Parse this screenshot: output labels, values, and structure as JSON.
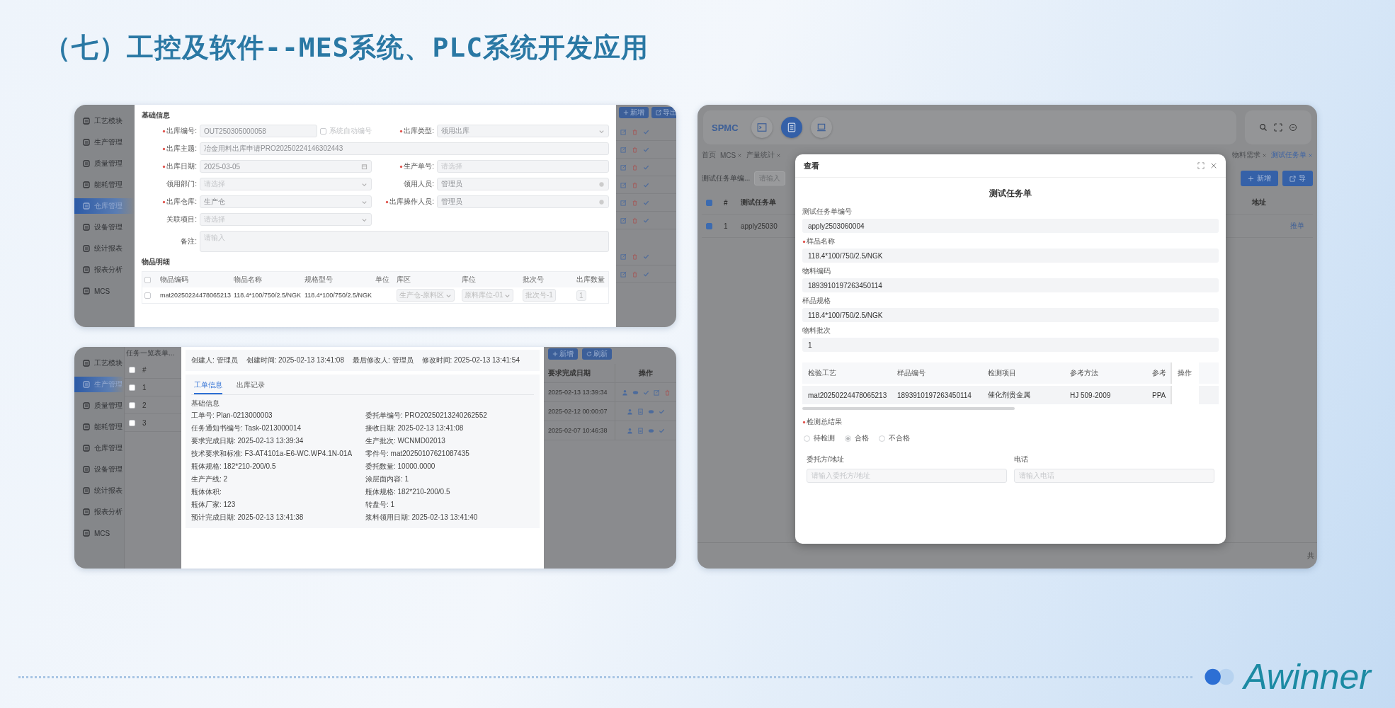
{
  "slide": {
    "title": "（七）工控及软件--MES系统、PLC系统开发应用",
    "logo": "Awinner"
  },
  "outbound_screen": {
    "sidebar": [
      {
        "label": "工艺模块",
        "selected": false
      },
      {
        "label": "生产管理",
        "selected": false
      },
      {
        "label": "质量管理",
        "selected": false
      },
      {
        "label": "能耗管理",
        "selected": false
      },
      {
        "label": "仓库管理",
        "selected": true
      },
      {
        "label": "设备管理",
        "selected": false
      },
      {
        "label": "统计报表",
        "selected": false
      },
      {
        "label": "报表分析",
        "selected": false
      },
      {
        "label": "MCS",
        "selected": false
      }
    ],
    "section_basic": "基础信息",
    "form_rows": [
      {
        "kind": "pair",
        "fields": [
          {
            "label": "出库编号:",
            "required": true,
            "kind": "text",
            "value": "OUT250305000058",
            "option": {
              "label": "系统自动编号",
              "checked": false
            }
          },
          {
            "label": "出库类型:",
            "required": true,
            "kind": "select",
            "value": "领用出库"
          }
        ]
      },
      {
        "kind": "wide",
        "fields": [
          {
            "label": "出库主题:",
            "required": true,
            "kind": "text",
            "value": "冶金用料出库申请PRO20250224146302443"
          }
        ]
      },
      {
        "kind": "pair",
        "fields": [
          {
            "label": "出库日期:",
            "required": true,
            "kind": "date",
            "value": "2025-03-05"
          },
          {
            "label": "生产单号:",
            "required": true,
            "kind": "text",
            "placeholder": "请选择"
          }
        ]
      },
      {
        "kind": "pair",
        "fields": [
          {
            "label": "领用部门:",
            "required": false,
            "kind": "select",
            "placeholder": "请选择"
          },
          {
            "label": "领用人员:",
            "required": false,
            "kind": "person",
            "value": "管理员"
          }
        ]
      },
      {
        "kind": "pair",
        "fields": [
          {
            "label": "出库仓库:",
            "required": true,
            "kind": "select",
            "value": "生产仓"
          },
          {
            "label": "出库操作人员:",
            "required": true,
            "kind": "person",
            "value": "管理员"
          }
        ]
      },
      {
        "kind": "pair",
        "fields": [
          {
            "label": "关联项目:",
            "required": false,
            "kind": "select",
            "placeholder": "请选择"
          }
        ]
      },
      {
        "kind": "wide",
        "fields": [
          {
            "label": "备注:",
            "required": false,
            "kind": "textarea",
            "placeholder": "请输入"
          }
        ]
      }
    ],
    "section_items": "物品明细",
    "items_table": {
      "header_checked": false,
      "columns": [
        "物品编码",
        "物品名称",
        "规格型号",
        "单位",
        "库区",
        "库位",
        "批次号",
        "出库数量"
      ],
      "rows": [
        {
          "checked": false,
          "code": "mat20250224478065213",
          "name": "118.4*100/750/2.5/NGK",
          "spec": "118.4*100/750/2.5/NGK",
          "zone": "生产仓-原料区",
          "location": "原料库位-01",
          "batch": "批次号-1",
          "quantity": "1"
        }
      ]
    },
    "toolbar_buttons": [
      {
        "label": "新增",
        "kind": "add"
      },
      {
        "label": "导出",
        "kind": "export"
      }
    ]
  },
  "work_order_screen": {
    "sidebar": [
      {
        "label": "工艺模块",
        "selected": false
      },
      {
        "label": "生产管理",
        "selected": true
      },
      {
        "label": "质量管理",
        "selected": false
      },
      {
        "label": "能耗管理",
        "selected": false
      },
      {
        "label": "仓库管理",
        "selected": false
      },
      {
        "label": "设备管理",
        "selected": false
      },
      {
        "label": "统计报表",
        "selected": false
      },
      {
        "label": "报表分析",
        "selected": false
      },
      {
        "label": "MCS",
        "selected": false
      }
    ],
    "list_title": "任务一览表单...",
    "list_header": "#",
    "list_header_checked": false,
    "list_rows": [
      {
        "index": "1",
        "checked": false
      },
      {
        "index": "2",
        "checked": false
      },
      {
        "index": "3",
        "checked": false
      }
    ],
    "meta": [
      "创建人: 管理员",
      "创建时间: 2025-02-13 13:41:08",
      "最后修改人: 管理员",
      "修改时间: 2025-02-13 13:41:54"
    ],
    "tabs": [
      {
        "label": "工单信息",
        "selected": true
      },
      {
        "label": "出库记录",
        "selected": false
      }
    ],
    "section": "基础信息",
    "details_left": [
      "工单号: Plan-0213000003",
      "任务通知书编号: Task-0213000014",
      "要求完成日期: 2025-02-13 13:39:34",
      "技术要求和标准: F3-AT4101a-E6-WC.WP4.1N-01A",
      "瓶体规格: 182*210-200/0.5",
      "生产产线: 2",
      "瓶体体积:",
      "瓶体厂家: 123",
      "预计完成日期: 2025-02-13 13:41:38"
    ],
    "details_right": [
      "委托单编号: PRO20250213240262552",
      "接收日期: 2025-02-13 13:41:08",
      "生产批次: WCNMD02013",
      "零件号: mat20250107621087435",
      "委托数量: 10000.0000",
      "涂层面内容: 1",
      "瓶体规格: 182*210-200/0.5",
      "转盘号: 1",
      "浆料领用日期: 2025-02-13 13:41:40"
    ],
    "toolbar_buttons": [
      {
        "label": "新增",
        "kind": "add"
      },
      {
        "label": "刷新",
        "kind": "refresh"
      }
    ],
    "table": {
      "columns": [
        "要求完成日期",
        "操作"
      ],
      "rows": [
        {
          "date": "2025-02-13 13:39:34",
          "actions": [
            {
              "kind": "assign"
            },
            {
              "kind": "view"
            },
            {
              "kind": "approve"
            },
            {
              "kind": "edit"
            },
            {
              "kind": "delete"
            }
          ]
        },
        {
          "date": "2025-02-12 00:00:07",
          "actions": [
            {
              "kind": "assign"
            },
            {
              "kind": "doc"
            },
            {
              "kind": "view"
            },
            {
              "kind": "approve"
            }
          ]
        },
        {
          "date": "2025-02-07 10:46:38",
          "actions": [
            {
              "kind": "assign"
            },
            {
              "kind": "doc"
            },
            {
              "kind": "view"
            },
            {
              "kind": "approve"
            }
          ]
        }
      ]
    }
  },
  "task_screen": {
    "brand": "SPMC",
    "nav_buttons": [
      {
        "kind": "terminal",
        "selected": false
      },
      {
        "kind": "list",
        "selected": true
      },
      {
        "kind": "laptop",
        "selected": false
      }
    ],
    "tabs": {
      "left": [
        {
          "label": "首页",
          "closable": false,
          "selected": false
        },
        {
          "label": "MCS",
          "closable": true,
          "selected": false
        },
        {
          "label": "产量统计",
          "closable": true,
          "selected": false
        }
      ],
      "right": [
        {
          "label": "物料需求",
          "closable": true,
          "selected": false
        },
        {
          "label": "测试任务单",
          "closable": true,
          "selected": true
        }
      ]
    },
    "filter": {
      "label": "测试任务单编...",
      "placeholder": "请输入"
    },
    "buttons": [
      {
        "label": "新增",
        "kind": "add"
      },
      {
        "label": "导",
        "kind": "export"
      }
    ],
    "table": {
      "header_checked": true,
      "columns": [
        "#",
        "测试任务单",
        "地址"
      ],
      "rows": [
        {
          "checked": true,
          "index": "1",
          "number": "apply25030",
          "action": "推单"
        }
      ]
    },
    "footer": "共",
    "dialog": {
      "title": "查看",
      "heading": "测试任务单",
      "fields": [
        {
          "label": "测试任务单编号",
          "required": false,
          "value": "apply2503060004"
        },
        {
          "label": "样品名称",
          "required": true,
          "value": "118.4*100/750/2.5/NGK"
        },
        {
          "label": "物料编码",
          "required": false,
          "value": "1893910197263450114"
        },
        {
          "label": "样品规格",
          "required": false,
          "value": "118.4*100/750/2.5/NGK"
        },
        {
          "label": "物料批次",
          "required": false,
          "value": "1"
        }
      ],
      "table": {
        "columns": [
          "检验工艺",
          "样品编号",
          "检测项目",
          "参考方法",
          "参考"
        ],
        "action_column": "操作",
        "rows": [
          [
            "mat20250224478065213",
            "1893910197263450114",
            "催化剂贵金属",
            "HJ 509-2009",
            "PPA"
          ]
        ]
      },
      "result": {
        "label": "检测总结果",
        "required": true,
        "options": [
          {
            "label": "待检测",
            "selected": false
          },
          {
            "label": "合格",
            "selected": true
          },
          {
            "label": "不合格",
            "selected": false
          }
        ]
      },
      "contact_fields": [
        {
          "label": "委托方/地址",
          "placeholder": "请输入委托方/地址"
        },
        {
          "label": "电话",
          "placeholder": "请输入电话"
        }
      ]
    }
  }
}
